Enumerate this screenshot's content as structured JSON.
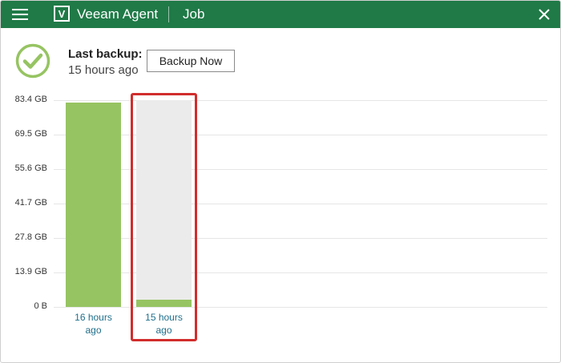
{
  "app": {
    "name": "Veeam Agent",
    "section": "Job",
    "logo_letter": "V"
  },
  "icons": {
    "menu": "hamburger-menu-icon",
    "logo": "veeam-logo-icon",
    "close": "close-icon",
    "status": "check-circle-icon"
  },
  "colors": {
    "titlebar": "#1f7a47",
    "bar_fill": "#96c462",
    "bar_background": "#ebebeb",
    "highlight": "#d22d2d",
    "link_text": "#1f6f8b"
  },
  "status": {
    "label": "Last backup:",
    "time": "15 hours ago"
  },
  "actions": {
    "backup_now": "Backup Now"
  },
  "chart_data": {
    "type": "bar",
    "categories": [
      "16 hours ago",
      "15 hours ago"
    ],
    "category_lines": [
      [
        "16 hours",
        "ago"
      ],
      [
        "15 hours",
        "ago"
      ]
    ],
    "values": [
      82.5,
      3.0
    ],
    "unit": "GB",
    "ylim": [
      0,
      83.4
    ],
    "y_ticks": [
      "83.4 GB",
      "69.5 GB",
      "55.6 GB",
      "41.7 GB",
      "27.8 GB",
      "13.9 GB",
      "0 B"
    ],
    "grid": true,
    "highlighted_category": "15 hours ago"
  }
}
